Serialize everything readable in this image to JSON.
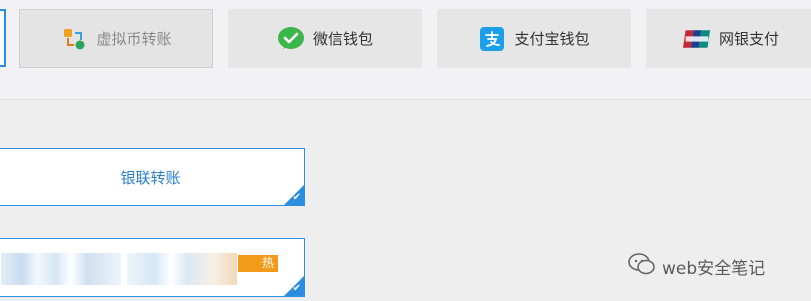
{
  "payment_tabs": [
    {
      "label": "虚拟币转账",
      "icon": "crypto-transfer-icon",
      "state": "selected"
    },
    {
      "label": "微信钱包",
      "icon": "wechat-icon"
    },
    {
      "label": "支付宝钱包",
      "icon": "alipay-icon"
    },
    {
      "label": "网银支付",
      "icon": "unionpay-icon"
    }
  ],
  "options": [
    {
      "label": "银联转账",
      "selected": true
    },
    {
      "badge": "热",
      "selected": true
    }
  ],
  "watermark": {
    "text": "web安全笔记"
  },
  "colors": {
    "accent": "#2b8ee0",
    "hot_badge": "#f39a1a",
    "wechat": "#3bb64a",
    "alipay": "#1a9fe8",
    "unionpay": "#c5282f"
  }
}
